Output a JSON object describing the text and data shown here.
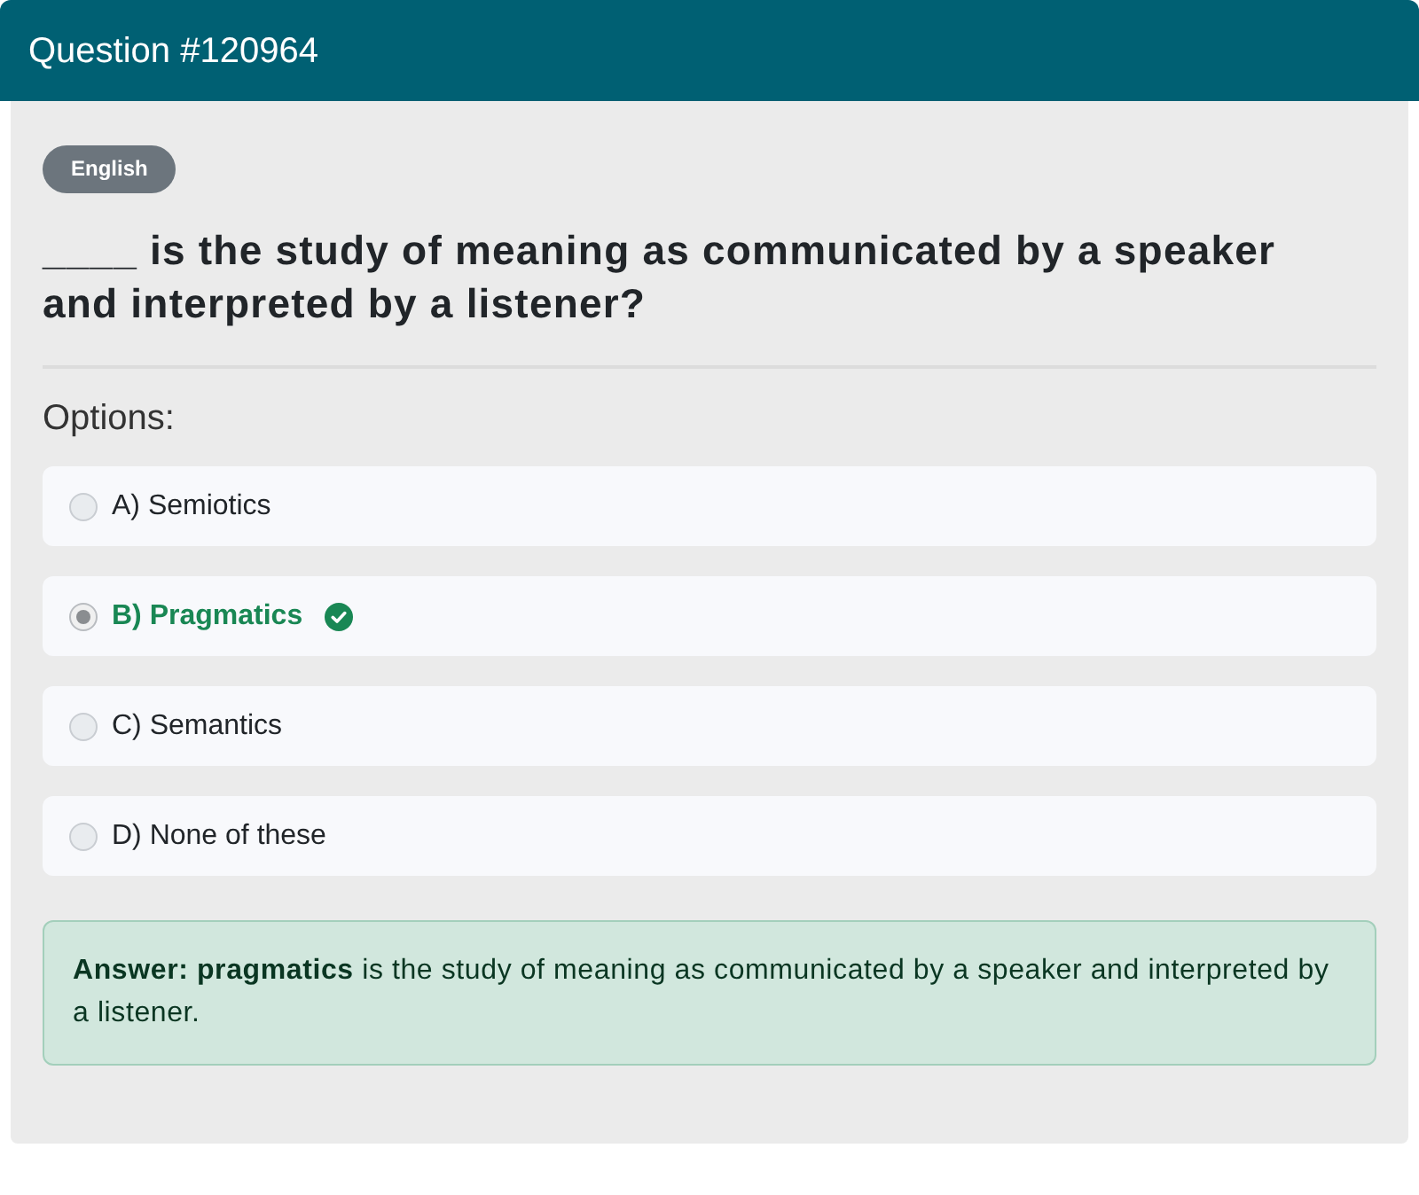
{
  "header": {
    "title": "Question #120964"
  },
  "badge": {
    "label": "English"
  },
  "question": {
    "text": "____ is the study of meaning as communicated by a speaker and interpreted by a listener?"
  },
  "options_heading": "Options:",
  "options": [
    {
      "label": "A) Semiotics",
      "selected": false,
      "correct": false
    },
    {
      "label": "B) Pragmatics",
      "selected": true,
      "correct": true
    },
    {
      "label": "C) Semantics",
      "selected": false,
      "correct": false
    },
    {
      "label": "D) None of these",
      "selected": false,
      "correct": false
    }
  ],
  "answer": {
    "text": "**Answer: pragmatics** is the study of meaning as communicated by a speaker and interpreted by a listener."
  }
}
